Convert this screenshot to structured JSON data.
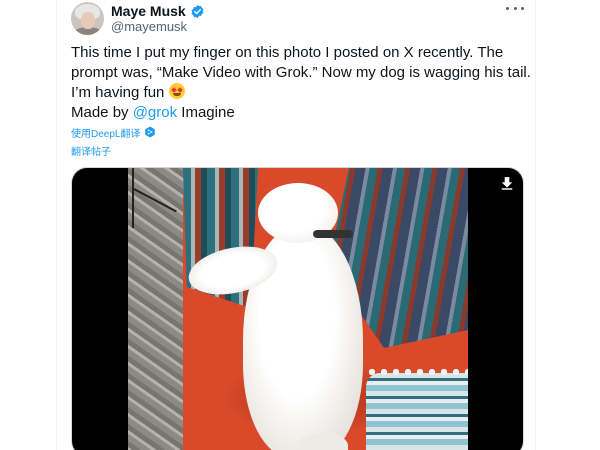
{
  "author": {
    "display_name": "Maye Musk",
    "handle": "@mayemusk",
    "verified": true
  },
  "tweet": {
    "text_before_emoji": "This time I put my finger on this photo I posted on X recently. The prompt was, “Make Video with Grok.” Now my dog is wagging his tail. I’m having fun",
    "emoji": "star-struck",
    "made_by_prefix": "Made by ",
    "made_by_mention": "@grok",
    "made_by_suffix": " Imagine"
  },
  "translation": {
    "deepl_label": "使用DeepL翻译",
    "translate_post": "翻译帖子"
  },
  "media": {
    "type": "video",
    "download_icon": "download-icon"
  },
  "colors": {
    "accent": "#1d9bf0",
    "text": "#0f1419",
    "secondary": "#536471"
  }
}
